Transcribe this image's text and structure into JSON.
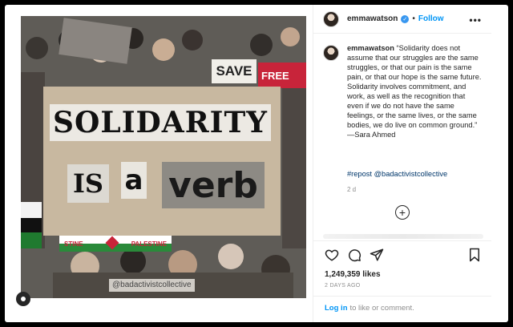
{
  "post": {
    "username": "emmawatson",
    "follow_label": "Follow",
    "dot": "•",
    "more_label": "•••"
  },
  "image": {
    "sign_word_1": "SOLIDARITY",
    "sign_word_2": "IS",
    "sign_word_3": "a",
    "sign_word_4": "verb",
    "watermark": "@badactivistcollective",
    "mini_sign_1": "SAVE",
    "mini_sign_2": "FREE",
    "banner_left": "STINE",
    "banner_right": "PALESTINE"
  },
  "caption": {
    "username": "emmawatson",
    "text": "“Solidarity does not assume that our struggles are the same struggles, or that our pain is the same pain, or that our hope is the same future. Solidarity involves commitment, and work, as well as the recognition that even if we do not have the same feelings, or the same lives, or the same bodies, we do live on common ground.” —Sara Ahmed",
    "tags": "#repost @badactivistcollective",
    "time": "2 d"
  },
  "stats": {
    "likes": "1,249,359 likes",
    "ago": "2 DAYS AGO"
  },
  "footer": {
    "login_link": "Log in",
    "login_text": "to like or comment."
  },
  "icons": {
    "verified": "verified-badge-icon",
    "add": "add-comment-icon",
    "like": "heart-icon",
    "comment": "comment-icon",
    "share": "share-icon",
    "save": "bookmark-icon"
  },
  "colors": {
    "link": "#0095f6",
    "verified": "#3897f0",
    "tag": "#00376b"
  }
}
